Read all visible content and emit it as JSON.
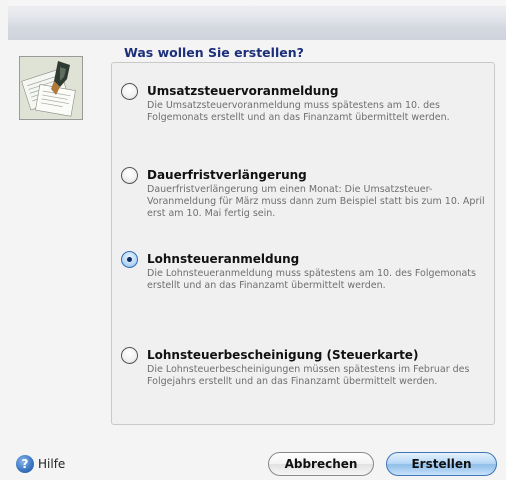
{
  "dialog": {
    "heading": "Was wollen Sie erstellen?"
  },
  "options": [
    {
      "title": "Umsatzsteuervoranmeldung",
      "desc": "Die Umsatzsteuervoranmeldung muss spätestens am 10. des Folgemonats erstellt und an das Finanzamt übermittelt werden.",
      "selected": false
    },
    {
      "title": "Dauerfristverlängerung",
      "desc": "Dauerfristverlängerung um einen Monat: Die Umsatzsteuer-Voranmeldung für März muss dann zum Beispiel statt bis zum 10. April erst am 10. Mai fertig sein.",
      "selected": false
    },
    {
      "title": "Lohnsteueranmeldung",
      "desc": "Die Lohnsteueranmeldung muss spätestens am 10. des Folgemonats erstellt und an das Finanzamt übermittelt werden.",
      "selected": true
    },
    {
      "title": "Lohnsteuerbescheinigung (Steuerkarte)",
      "desc": "Die Lohnsteuerbescheinigungen müssen spätestens im Februar des Folgejahrs erstellt und an das Finanzamt übermittelt werden.",
      "selected": false
    }
  ],
  "footer": {
    "help_icon_glyph": "?",
    "help_label": "Hilfe",
    "cancel_label": "Abbrechen",
    "create_label": "Erstellen"
  },
  "colors": {
    "heading": "#1d2f7a",
    "radio_selected": "#2f6fb6",
    "primary_button": "#8ebee9"
  },
  "icons": {
    "thumbnail": "tax-documents-image",
    "help": "help-icon"
  }
}
